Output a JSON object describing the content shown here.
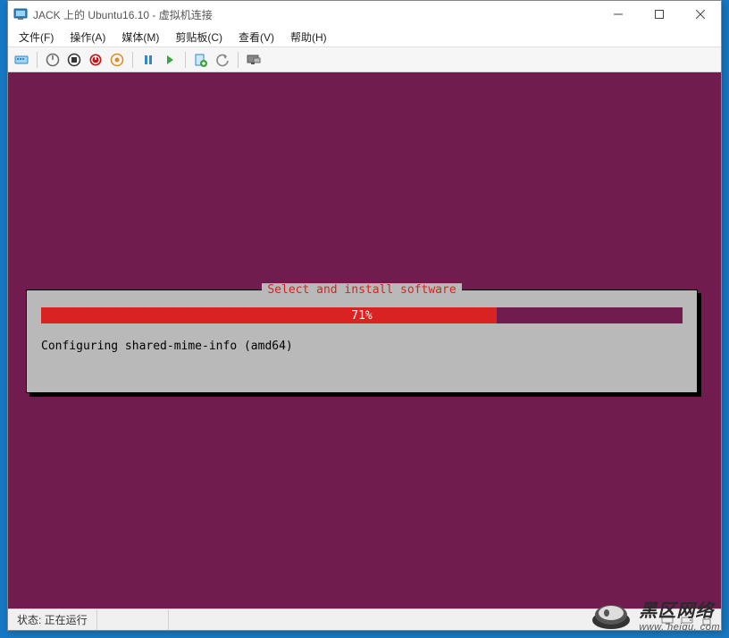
{
  "window": {
    "title": "JACK 上的 Ubuntu16.10 - 虚拟机连接"
  },
  "menu": {
    "file": "文件(F)",
    "action": "操作(A)",
    "media": "媒体(M)",
    "clipboard": "剪贴板(C)",
    "view": "查看(V)",
    "help": "帮助(H)"
  },
  "installer": {
    "title": "Select and install software",
    "progress_percent": 71,
    "progress_label": "71%",
    "status": "Configuring shared-mime-info (amd64)"
  },
  "statusbar": {
    "status": "状态: 正在运行"
  },
  "watermark": {
    "line1": "黑区网络",
    "line2": "www. heiqu. com"
  },
  "colors": {
    "vm_bg": "#701c4e",
    "progress_fill": "#d92222",
    "panel_bg": "#b9b9b9"
  }
}
